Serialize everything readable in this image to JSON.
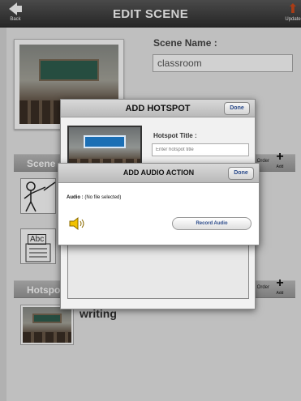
{
  "header": {
    "title": "EDIT SCENE",
    "back_label": "Back",
    "update_label": "Update"
  },
  "scene": {
    "name_label": "Scene Name :",
    "name_value": "classroom"
  },
  "sections": {
    "scene_actions": {
      "label": "Scene Actions",
      "order_label": "Order",
      "add_label": "Add"
    },
    "hotspots": {
      "label": "Hotspots",
      "order_label": "Order",
      "add_label": "Add"
    }
  },
  "text_icon_label": "Abc",
  "hotspot_item": {
    "title": "writing"
  },
  "add_hotspot_dialog": {
    "title": "ADD HOTSPOT",
    "done_label": "Done",
    "title_label": "Hotspot Title :",
    "title_placeholder": "Enter hotspot title"
  },
  "add_audio_dialog": {
    "title": "ADD AUDIO ACTION",
    "done_label": "Done",
    "audio_label": "Audio :",
    "audio_value": "(No file selected)",
    "record_label": "Record Audio"
  },
  "colors": {
    "topbar": "#3c3c3c",
    "speaker": "#f2c200",
    "button_text": "#2a4a8a"
  }
}
